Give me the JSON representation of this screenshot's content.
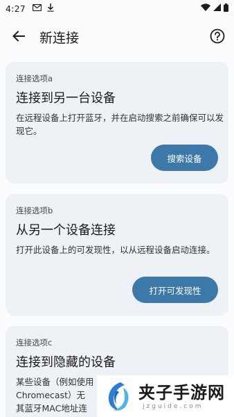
{
  "status_bar": {
    "time": "4:27",
    "icons_left": [
      "gmail-icon",
      "download-icon"
    ],
    "icons_right": [
      "wifi-icon",
      "signal-icon",
      "battery-icon"
    ]
  },
  "app_bar": {
    "title": "新连接",
    "back_icon": "arrow-back-icon",
    "help_icon": "help-circle-icon"
  },
  "cards": [
    {
      "option_label": "连接选项a",
      "title": "连接到另一台设备",
      "description": "在远程设备上打开蓝牙，并在启动搜索之前确保可以发现它。",
      "button_label": "搜索设备"
    },
    {
      "option_label": "连接选项b",
      "title": "从另一个设备连接",
      "description": "打开此设备上的可发现性，以从远程设备启动连接。",
      "button_label": "打开可发现性"
    },
    {
      "option_label": "连接选项c",
      "title": "连接到隐藏的设备",
      "description_lines": [
        "某些设备（例如使用",
        "Chromecast）无",
        "其蓝牙MAC地址连"
      ]
    }
  ],
  "watermark": {
    "text": "夹子手游网",
    "subtext": "jzguide.com"
  },
  "colors": {
    "accent": "#3d79a8",
    "card_bg": "#eef2f6",
    "page_bg": "#fbfcfd"
  }
}
